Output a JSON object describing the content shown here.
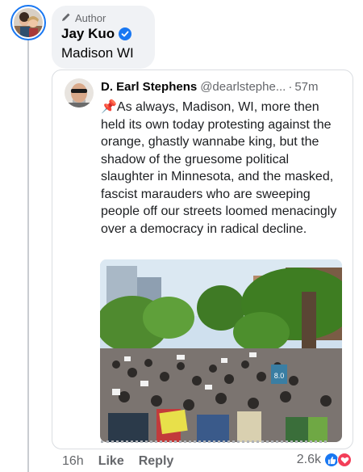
{
  "comment": {
    "author_badge": "Author",
    "name": "Jay Kuo",
    "text": "Madison WI",
    "time": "16h",
    "like_label": "Like",
    "reply_label": "Reply",
    "reaction_count": "2.6k",
    "reactions": [
      "like-icon",
      "love-icon"
    ]
  },
  "shared_post": {
    "name": "D. Earl Stephens",
    "handle": "@dearlstephe...",
    "dot": "·",
    "time": "57m",
    "pin": "📌",
    "body": "As always, Madison, WI, more then held its own today protesting against the orange, ghastly wannabe king, but the shadow of the gruesome political slaughter in Minnesota, and the masked, fascist marauders who are sweeping people off our streets loomed menacingly over a democracy in radical decline.",
    "photo_sign_text": "8.0"
  },
  "colors": {
    "accent": "#1877f2",
    "love": "#f33e58",
    "muted": "#65676b"
  }
}
